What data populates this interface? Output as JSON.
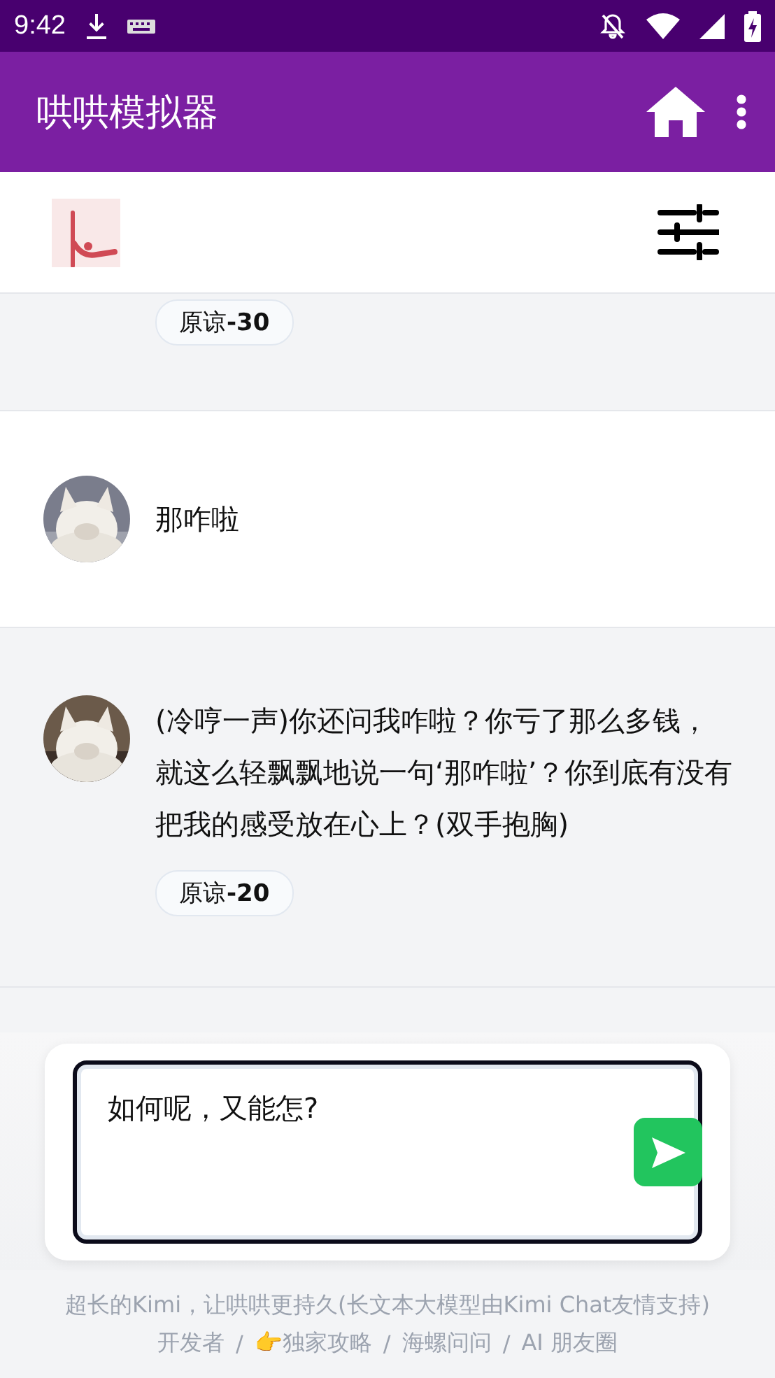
{
  "status_bar": {
    "time": "9:42"
  },
  "app_bar": {
    "title": "哄哄模拟器"
  },
  "messages": [
    {
      "kind": "assistant",
      "badge": "原谅**-30**"
    },
    {
      "kind": "user",
      "text": "那咋啦"
    },
    {
      "kind": "assistant",
      "text": "(冷哼一声)你还问我咋啦？你亏了那么多钱，就这么轻飘飘地说一句‘那咋啦’？你到底有没有把我的感受放在心上？(双手抱胸)",
      "badge": "原谅**-20**"
    }
  ],
  "composer": {
    "value": "如何呢，又能怎?"
  },
  "footer": {
    "note": "超长的Kimi，让哄哄更持久(长文本大模型由Kimi Chat友情支持)",
    "links": [
      "开发者",
      "👉独家攻略",
      "海螺问问",
      "AI 朋友圈"
    ],
    "separator": "/"
  }
}
